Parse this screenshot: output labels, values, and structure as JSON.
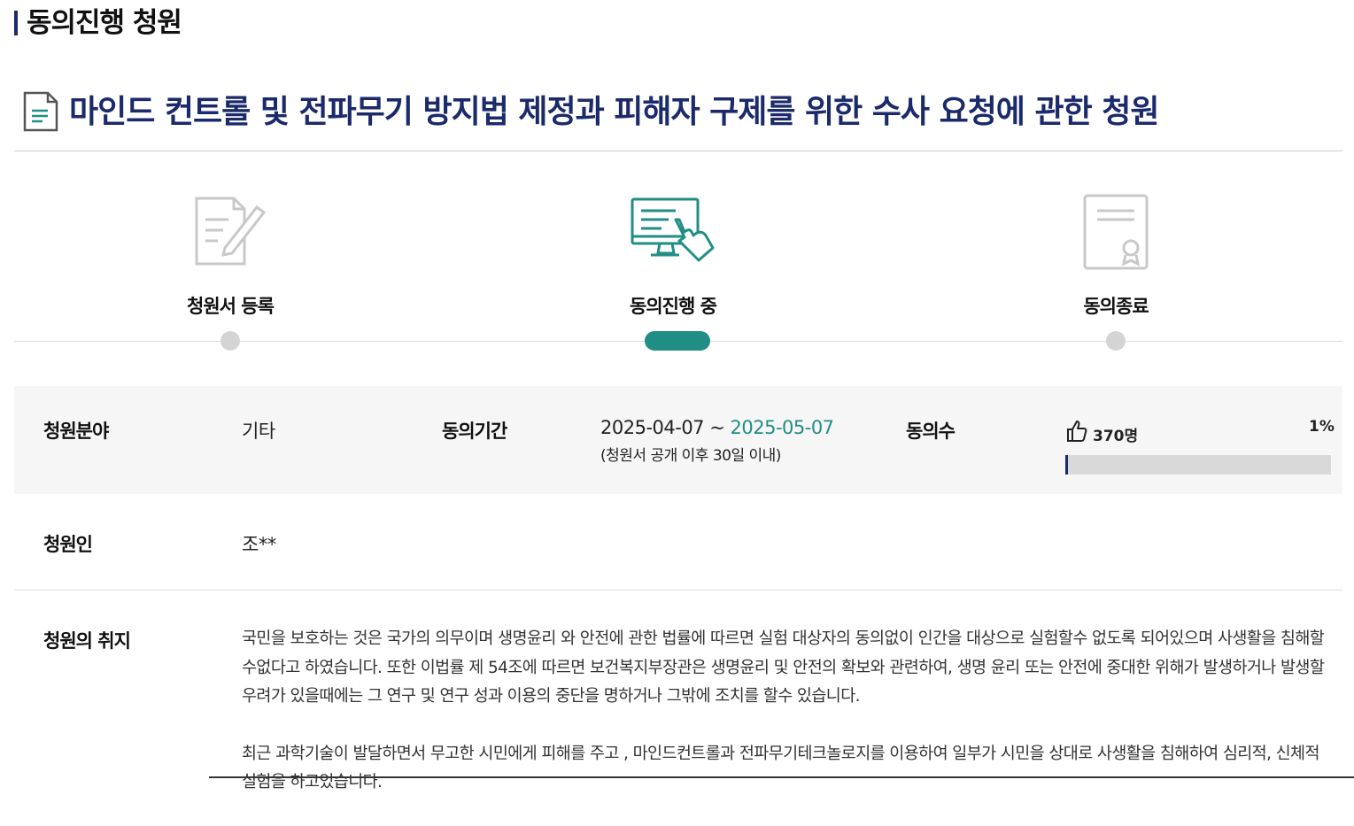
{
  "section_title": "동의진행 청원",
  "petition_title": "마인드 컨트롤 및 전파무기 방지법 제정과 피해자 구제를 위한 수사 요청에 관한 청원",
  "steps": [
    {
      "label": "청원서 등록",
      "icon": "document-pen-icon",
      "state": "done"
    },
    {
      "label": "동의진행 중",
      "icon": "monitor-hand-icon",
      "state": "active"
    },
    {
      "label": "동의종료",
      "icon": "certificate-icon",
      "state": "pending"
    }
  ],
  "colors": {
    "accent": "#218e85",
    "navy": "#1b2a6b",
    "inactive": "#d4d4d4"
  },
  "info": {
    "field_label": "청원분야",
    "field_value": "기타",
    "period_label": "동의기간",
    "period_start": "2025-04-07 ~ ",
    "period_end": "2025-05-07",
    "period_note": "(청원서 공개 이후 30일 이내)",
    "count_label": "동의수",
    "count_value": "370명",
    "count_percent": "1%",
    "progress": 0.01,
    "petitioner_label": "청원인",
    "petitioner_value": "조**",
    "purpose_label": "청원의 취지"
  },
  "body": {
    "p1": "국민을 보호하는 것은 국가의 의무이며 생명윤리 와 안전에 관한 법률에 따르면 실험 대상자의 동의없이 인간을 대상으로 실험할수 없도록 되어있으며 사생활을 침해할수없다고 하였습니다. 또한 이법률 제 54조에 따르면 보건복지부장관은 생명윤리 및 안전의 확보와 관련하여, 생명 윤리 또는 안전에 중대한 위해가 발생하거나 발생할 우려가 있을때에는 그 연구 및 연구 성과 이용의 중단을 명하거나 그밖에 조치를 할수 있습니다.",
    "p2": "최근 과학기술이 발달하면서 무고한 시민에게 피해를 주고 , 마인드컨트롤과 전파무기테크놀로지를 이용하여 일부가 시민을 상대로 사생활을 침해하여 심리적, 신체적 실험을 하고있습니다."
  }
}
